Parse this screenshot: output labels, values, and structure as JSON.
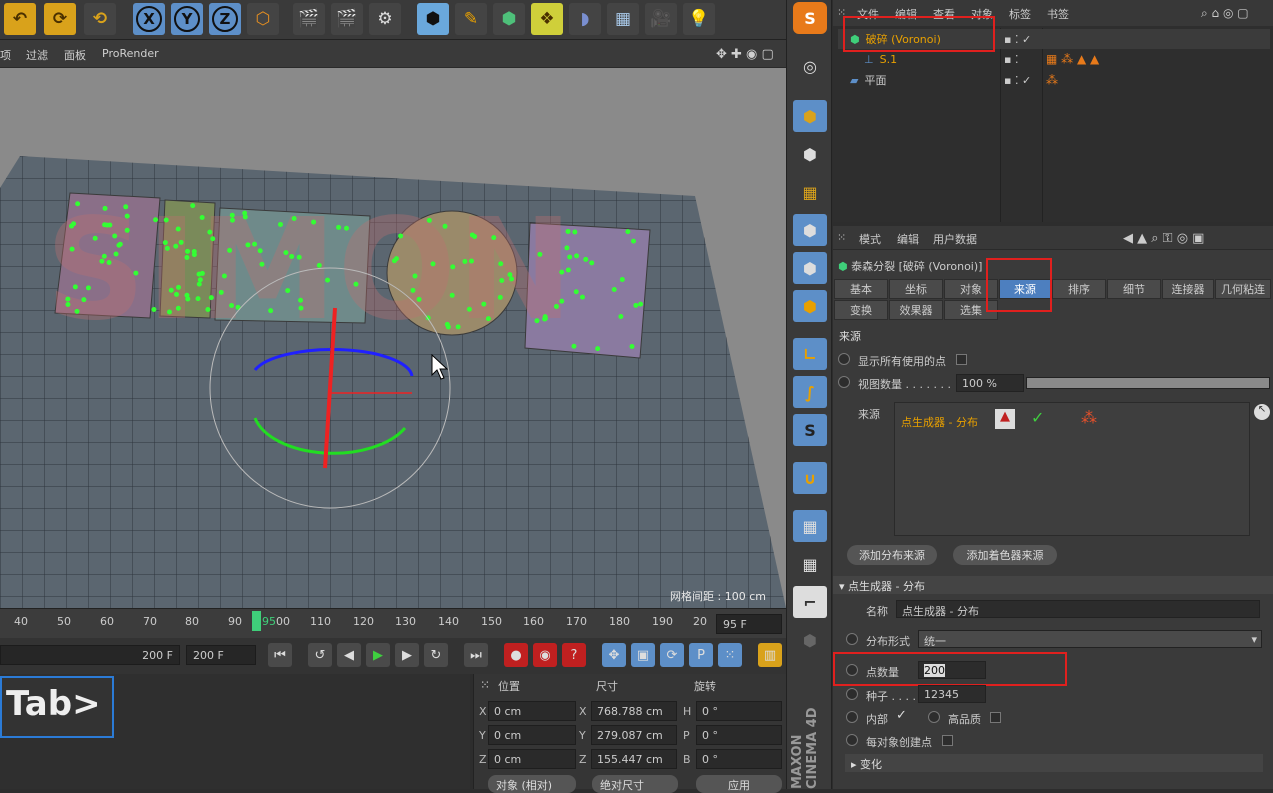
{
  "toolbar": {
    "items": [
      "undo-icon",
      "redo-icon",
      "redo-alt-icon",
      "x-axis",
      "y-axis",
      "z-axis",
      "coord-system-icon",
      "render-view-icon",
      "render-icon",
      "render-settings-icon",
      "cube-icon",
      "pen-icon",
      "subdivision-icon",
      "cloner-icon",
      "deformer-icon",
      "floor-icon",
      "camera-icon",
      "light-icon"
    ],
    "axis_x": "X",
    "axis_y": "Y",
    "axis_z": "Z"
  },
  "viewport_menu": {
    "items": [
      "项",
      "过滤",
      "面板",
      "ProRender"
    ]
  },
  "viewport": {
    "grid_info": "网格间距 : 100 cm",
    "object_text": "SIMON"
  },
  "timeline": {
    "ticks": [
      "40",
      "50",
      "60",
      "70",
      "80",
      "90",
      "95",
      "00",
      "110",
      "120",
      "130",
      "140",
      "150",
      "160",
      "170",
      "180",
      "190",
      "20"
    ],
    "current": "95",
    "frame_field": "95 F"
  },
  "playbar": {
    "start_field": "200 F",
    "end_field": "200 F"
  },
  "tab_overlay": "Tab>",
  "coords": {
    "headers": {
      "position": "位置",
      "size": "尺寸",
      "rotation": "旋转"
    },
    "rows": [
      {
        "axis": "X",
        "pos": "0 cm",
        "size_axis": "X",
        "size": "768.788 cm",
        "rot_axis": "H",
        "rot": "0 °"
      },
      {
        "axis": "Y",
        "pos": "0 cm",
        "size_axis": "Y",
        "size": "279.087 cm",
        "rot_axis": "P",
        "rot": "0 °"
      },
      {
        "axis": "Z",
        "pos": "0 cm",
        "size_axis": "Z",
        "size": "155.447 cm",
        "rot_axis": "B",
        "rot": "0 °"
      }
    ],
    "mode_dropdown": "对象 (相对)",
    "size_dropdown": "绝对尺寸",
    "apply_button": "应用"
  },
  "sidebar": {
    "maxon_logo": "MAXON CINEMA 4D"
  },
  "object_manager": {
    "menu": [
      "文件",
      "编辑",
      "查看",
      "对象",
      "标签",
      "书签"
    ],
    "objects": [
      {
        "name": "破碎 (Voronoi)",
        "color": "#e8a000"
      },
      {
        "name": "S.1",
        "color": "#e8a000"
      },
      {
        "name": "平面",
        "color": "#c8c8c8"
      }
    ]
  },
  "attr_manager": {
    "menu": [
      "模式",
      "编辑",
      "用户数据"
    ],
    "title": "泰森分裂 [破碎 (Voronoi)]",
    "tabs_row1": [
      "基本",
      "坐标",
      "对象",
      "来源",
      "排序",
      "细节",
      "连接器",
      "几何粘连"
    ],
    "tabs_row2": [
      "变换",
      "效果器",
      "选集"
    ],
    "active_tab": "来源",
    "section_source": "来源",
    "show_all_points": "显示所有使用的点",
    "viewport_count_label": "视图数量 . . . . . . .",
    "viewport_count_value": "100 %",
    "viewport_count_fraction": 1.0,
    "source_label": "来源",
    "source_item": "点生成器 - 分布",
    "add_dist_button": "添加分布来源",
    "add_shader_button": "添加着色器来源",
    "subsection": "点生成器 - 分布",
    "name_label": "名称",
    "name_value": "点生成器 - 分布",
    "dist_label": "分布形式",
    "dist_value": "统一",
    "count_label": "点数量",
    "count_value": "200",
    "seed_label": "种子 . . . .",
    "seed_value": "12345",
    "inside_label": "内部",
    "hq_label": "高品质",
    "per_object_label": "每对象创建点",
    "transform_section": "变化"
  },
  "colors": {
    "accent_blue": "#4d7fbf",
    "highlight_red": "#e0201e",
    "object_orange": "#e8a000",
    "points_green": "#33ff33"
  }
}
